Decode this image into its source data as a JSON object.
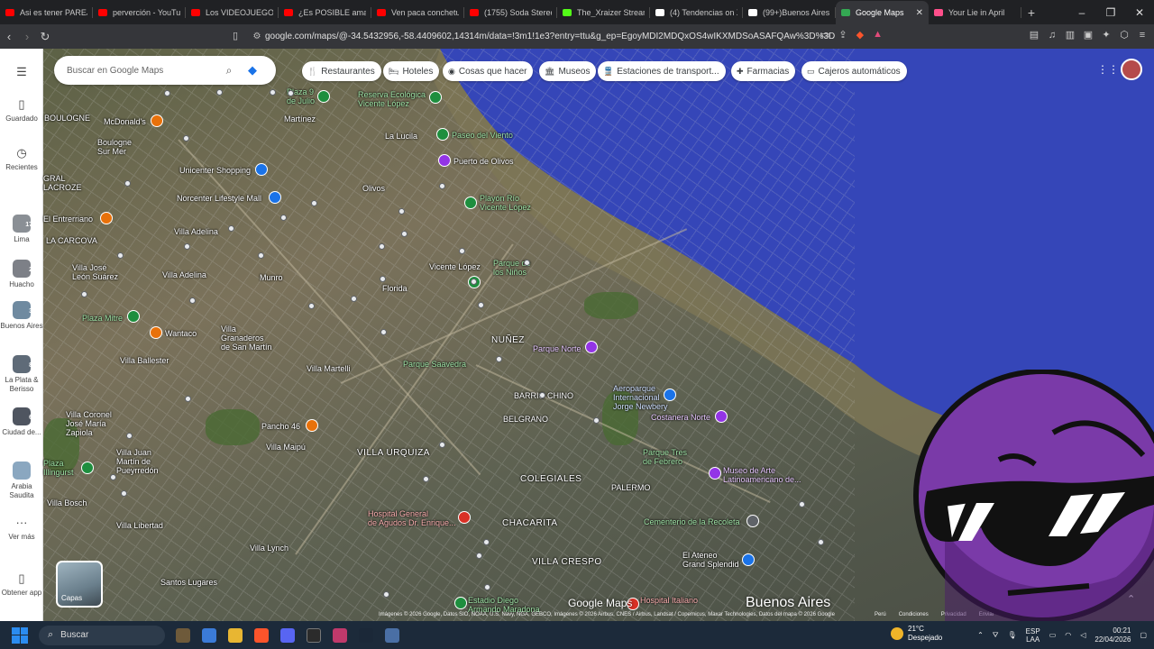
{
  "browser": {
    "tabs": [
      {
        "title": "Asi es tener PAREJA",
        "icon_color": "#ff0000"
      },
      {
        "title": "perverción - YouTube",
        "icon_color": "#ff0000"
      },
      {
        "title": "Los VIDEOJUEGOS",
        "icon_color": "#ff0000"
      },
      {
        "title": "¿Es POSIBLE amar e",
        "icon_color": "#ff0000"
      },
      {
        "title": "Ven paca conchetu",
        "icon_color": "#ff0000"
      },
      {
        "title": "(1755) Soda Stereo",
        "icon_color": "#ff0000"
      },
      {
        "title": "The_Xraizer Stream",
        "icon_color": "#53fc18"
      },
      {
        "title": "(4) Tendencias on X",
        "icon_color": "#ffffff"
      },
      {
        "title": "(99+)Buenos Aires",
        "icon_color": "#ffffff"
      },
      {
        "title": "Google Maps",
        "icon_color": "#34a853",
        "active": true
      },
      {
        "title": "Your Lie in April",
        "icon_color": "#ff4f8b"
      }
    ],
    "url": "google.com/maps/@-34.5432956,-58.4409602,14314m/data=!3m1!1e3?entry=ttu&g_ep=EgoyMDI2MDQxOS4wIKXMDSoASAFQAw%3D%3D"
  },
  "maps": {
    "search_placeholder": "Buscar en Google Maps",
    "chips": [
      {
        "label": "Restaurantes",
        "icon": "fork-knife-icon"
      },
      {
        "label": "Hoteles",
        "icon": "bed-icon"
      },
      {
        "label": "Cosas que hacer",
        "icon": "camera-icon"
      },
      {
        "label": "Museos",
        "icon": "museum-icon"
      },
      {
        "label": "Estaciones de transport...",
        "icon": "train-icon"
      },
      {
        "label": "Farmacias",
        "icon": "pharmacy-icon"
      },
      {
        "label": "Cajeros automáticos",
        "icon": "atm-icon"
      }
    ],
    "rail": {
      "saved": "Guardado",
      "recents": "Recientes",
      "places": [
        {
          "label": "Lima",
          "badge": "17"
        },
        {
          "label": "Huacho",
          "badge": "2"
        },
        {
          "label": "Buenos Aires",
          "badge": "3"
        },
        {
          "label": "La Plata & Berisso",
          "badge": "8"
        },
        {
          "label": "Ciudad de...",
          "badge": "6"
        },
        {
          "label": "Arabia Saudita",
          "badge": ""
        }
      ],
      "more": "Ver más",
      "get_app": "Obtener app"
    },
    "labels": {
      "martinez": "Martínez",
      "la_lucila": "La Lucila",
      "olivos": "Olivos",
      "vicente_lopez": "Vicente López",
      "florida": "Florida",
      "munro": "Munro",
      "villa_adelina": "Villa Adelina",
      "villa_adelina2": "Villa Adelina",
      "boulogne": "BOULOGNE",
      "boulogne_sur_mer": "Boulogne\nSur Mer",
      "nunez": "NUÑEZ",
      "barrio_chino": "BARRIO CHINO",
      "belgrano": "BELGRANO",
      "villa_urquiza": "VILLA URQUIZA",
      "colegiales": "COLEGIALES",
      "palermo": "PALERMO",
      "chacarita": "CHACARITA",
      "villa_crespo": "VILLA CRESPO",
      "villa_martelli": "Villa Martelli",
      "granaderos": "Villa\nGranaderos\nde San Martín",
      "villa_ballester": "Villa Ballester",
      "villa_maipu": "Villa Maipú",
      "villa_coronel": "Villa Coronel\nJosé María\nZapiola",
      "villa_juan_martin": "Villa Juan\nMartín de\nPueyrredón",
      "villa_bosch": "Villa Bosch",
      "villa_libertad": "Villa Libertad",
      "villa_lynch": "Villa Lynch",
      "santos_lugares": "Santos Lugares",
      "villa_jose_leon": "Villa José\nLeón Suárez",
      "la_carcova": "LA CARCOVA",
      "gral_lacroze": "GRAL\nLACROZE",
      "el_entrerriano": "El Entrerriano",
      "mcdonalds": "McDonald's",
      "unicenter": "Unicenter Shopping",
      "norcenter": "Norcenter Lifestyle Mall",
      "plaza9": "Plaza 9\nde Julio",
      "reserva": "Reserva Ecológica\nVicente López",
      "paseo_viento": "Paseo del Viento",
      "puerto_olivos": "Puerto de Olivos",
      "playon_rio": "Playón Río\nVicente López",
      "parque_ninos": "Parque de\nlos Niños",
      "parque_norte": "Parque Norte",
      "parque_saavedra": "Parque Saavedra",
      "aeroparque": "Aeroparque\nInternacional\nJorge Newbery",
      "costanera_norte": "Costanera Norte",
      "parque_tres_feb": "Parque Tres\nde Febrero",
      "museo_arte": "Museo de Arte\nLatinoamericano de...",
      "cementerio": "Cementerio de la Recoleta",
      "el_ateneo": "El Ateneo\nGrand Splendid",
      "hospital_general": "Hospital General\nde Agudos Dr. Enrique...",
      "hospital_italiano": "Hospital Italiano",
      "estadio_maradona": "Estadio Diego\nArmando Maradona",
      "pancho46": "Pancho 46",
      "wantaco": "Wantaco",
      "plaza_mitre": "Plaza Mitre",
      "plaza_bottom": "Plaza\nIllingurst",
      "city": "Buenos Aires"
    },
    "logo": "Google Maps",
    "layers_label": "Capas",
    "attribution": "Imágenes © 2026 Google, Datos SIO, NOAA, U.S. Navy, NGA, GEBCO, Imágenes © 2026 Airbus, CNES / Airbus, Landsat / Copernicus, Maxar Technologies, Datos del mapa © 2026 Google",
    "footer_links": [
      "Perú",
      "Condiciones",
      "Privacidad",
      "Enviar"
    ]
  },
  "taskbar": {
    "search": "Buscar",
    "temp": "21°C",
    "weather": "Despejado",
    "lang": "ESP\nLAA",
    "time": "00:21",
    "date": "22/04/2026"
  }
}
